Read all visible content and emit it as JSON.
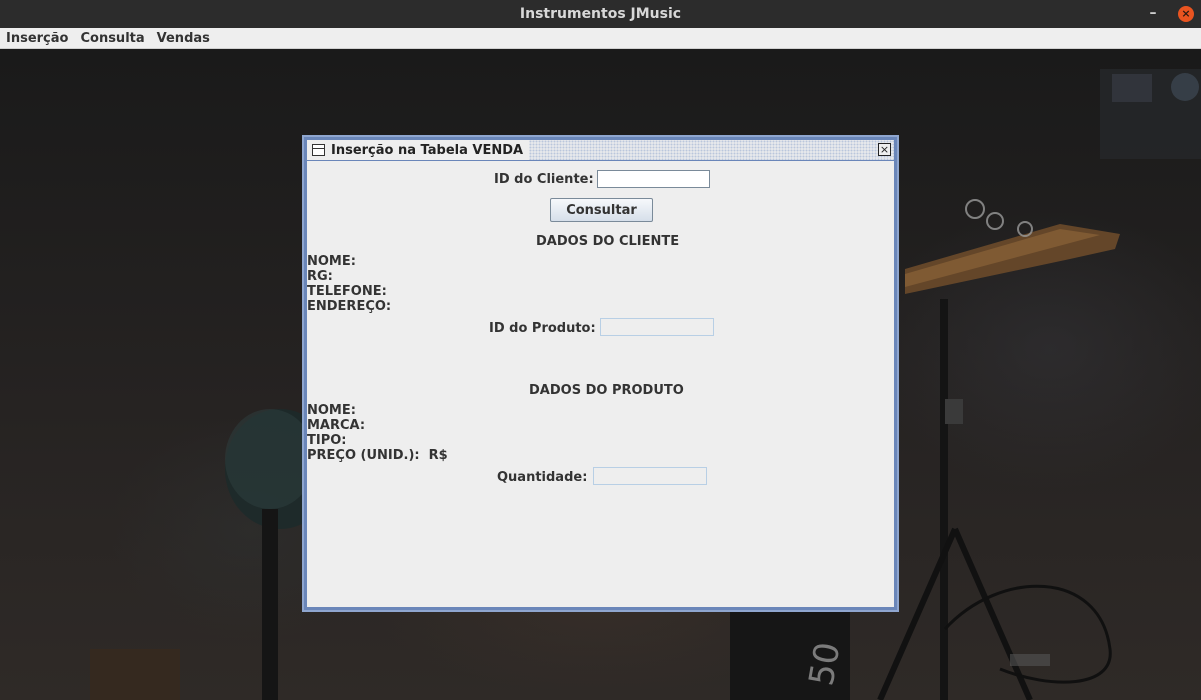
{
  "window": {
    "title": "Instrumentos JMusic",
    "minimize_glyph": "–",
    "close_glyph": "×"
  },
  "menubar": {
    "items": [
      "Inserção",
      "Consulta",
      "Vendas"
    ]
  },
  "dialog": {
    "title": "Inserção na Tabela VENDA",
    "close_glyph": "×",
    "cliente": {
      "id_label": "ID do Cliente:",
      "id_value": "",
      "button": "Consultar",
      "section_title": "DADOS DO CLIENTE",
      "fields": [
        "NOME:",
        "RG:",
        "TELEFONE:",
        "ENDEREÇO:"
      ]
    },
    "produto": {
      "id_label": "ID do Produto:",
      "id_value": "",
      "section_title": "DADOS DO PRODUTO",
      "fields": [
        "NOME:",
        "MARCA:",
        "TIPO:",
        "PREÇO (UNID.):  R$"
      ]
    },
    "quantidade": {
      "label": "Quantidade:",
      "value": ""
    }
  },
  "colors": {
    "os_titlebar": "#2c2c2c",
    "os_close": "#e95420",
    "frame_border": "#6a86b9",
    "panel": "#eeeeee"
  },
  "icons": [
    "window-icon",
    "close-icon",
    "minimize-icon"
  ]
}
